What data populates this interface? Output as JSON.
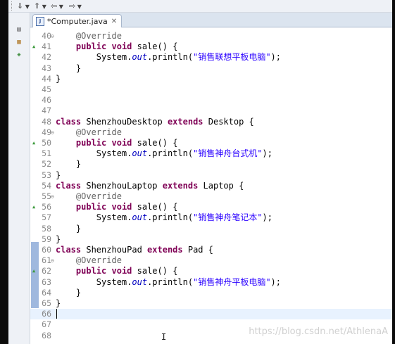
{
  "toolbar": {
    "items": [
      {
        "icon": "next-annotation-icon",
        "glyph": "⇓"
      },
      {
        "icon": "previous-annotation-icon",
        "glyph": "⇑"
      },
      {
        "icon": "back-icon",
        "glyph": "⇦"
      },
      {
        "icon": "forward-icon",
        "glyph": "⇨"
      }
    ]
  },
  "side_panel": {
    "icons": [
      "restore-icon",
      "hierarchy-icon",
      "outline-icon"
    ]
  },
  "editor": {
    "tab_title": "*Computer.java",
    "tab_close_glyph": "✕",
    "file_icon_glyph": "J",
    "current_line": 66,
    "lines": [
      {
        "n": "40",
        "fold": "⊖",
        "marker": "",
        "tokens": [
          [
            "",
            "    "
          ],
          [
            "ann",
            "@Override"
          ]
        ]
      },
      {
        "n": "41",
        "fold": "",
        "marker": "▲",
        "tokens": [
          [
            "",
            "    "
          ],
          [
            "kw",
            "public"
          ],
          [
            "",
            " "
          ],
          [
            "kw",
            "void"
          ],
          [
            "",
            " sale() {"
          ]
        ]
      },
      {
        "n": "42",
        "fold": "",
        "marker": "",
        "tokens": [
          [
            "",
            "        System."
          ],
          [
            "fld",
            "out"
          ],
          [
            "",
            ".println("
          ],
          [
            "str",
            "\"销售联想平板电脑\""
          ],
          [
            "",
            ");"
          ]
        ]
      },
      {
        "n": "43",
        "fold": "",
        "marker": "",
        "tokens": [
          [
            "",
            "    }"
          ]
        ]
      },
      {
        "n": "44",
        "fold": "",
        "marker": "",
        "tokens": [
          [
            "",
            "}"
          ]
        ]
      },
      {
        "n": "45",
        "fold": "",
        "marker": "",
        "tokens": []
      },
      {
        "n": "46",
        "fold": "",
        "marker": "",
        "tokens": []
      },
      {
        "n": "47",
        "fold": "",
        "marker": "",
        "tokens": []
      },
      {
        "n": "48",
        "fold": "",
        "marker": "",
        "tokens": [
          [
            "kw",
            "class"
          ],
          [
            "",
            " ShenzhouDesktop "
          ],
          [
            "kw",
            "extends"
          ],
          [
            "",
            " Desktop {"
          ]
        ]
      },
      {
        "n": "49",
        "fold": "⊖",
        "marker": "",
        "tokens": [
          [
            "",
            "    "
          ],
          [
            "ann",
            "@Override"
          ]
        ]
      },
      {
        "n": "50",
        "fold": "",
        "marker": "▲",
        "tokens": [
          [
            "",
            "    "
          ],
          [
            "kw",
            "public"
          ],
          [
            "",
            " "
          ],
          [
            "kw",
            "void"
          ],
          [
            "",
            " sale() {"
          ]
        ]
      },
      {
        "n": "51",
        "fold": "",
        "marker": "",
        "tokens": [
          [
            "",
            "        System."
          ],
          [
            "fld",
            "out"
          ],
          [
            "",
            ".println("
          ],
          [
            "str",
            "\"销售神舟台式机\""
          ],
          [
            "",
            ");"
          ]
        ]
      },
      {
        "n": "52",
        "fold": "",
        "marker": "",
        "tokens": [
          [
            "",
            "    }"
          ]
        ]
      },
      {
        "n": "53",
        "fold": "",
        "marker": "",
        "tokens": [
          [
            "",
            "}"
          ]
        ]
      },
      {
        "n": "54",
        "fold": "",
        "marker": "",
        "tokens": [
          [
            "kw",
            "class"
          ],
          [
            "",
            " ShenzhouLaptop "
          ],
          [
            "kw",
            "extends"
          ],
          [
            "",
            " Laptop {"
          ]
        ]
      },
      {
        "n": "55",
        "fold": "⊖",
        "marker": "",
        "tokens": [
          [
            "",
            "    "
          ],
          [
            "ann",
            "@Override"
          ]
        ]
      },
      {
        "n": "56",
        "fold": "",
        "marker": "▲",
        "tokens": [
          [
            "",
            "    "
          ],
          [
            "kw",
            "public"
          ],
          [
            "",
            " "
          ],
          [
            "kw",
            "void"
          ],
          [
            "",
            " sale() {"
          ]
        ]
      },
      {
        "n": "57",
        "fold": "",
        "marker": "",
        "tokens": [
          [
            "",
            "        System."
          ],
          [
            "fld",
            "out"
          ],
          [
            "",
            ".println("
          ],
          [
            "str",
            "\"销售神舟笔记本\""
          ],
          [
            "",
            ");"
          ]
        ]
      },
      {
        "n": "58",
        "fold": "",
        "marker": "",
        "tokens": [
          [
            "",
            "    }"
          ]
        ]
      },
      {
        "n": "59",
        "fold": "",
        "marker": "",
        "tokens": [
          [
            "",
            "}"
          ]
        ]
      },
      {
        "n": "60",
        "fold": "",
        "marker": "",
        "tokens": [
          [
            "kw",
            "class"
          ],
          [
            "",
            " ShenzhouPad "
          ],
          [
            "kw",
            "extends"
          ],
          [
            "",
            " Pad {"
          ]
        ]
      },
      {
        "n": "61",
        "fold": "⊖",
        "marker": "",
        "tokens": [
          [
            "",
            "    "
          ],
          [
            "ann",
            "@Override"
          ]
        ]
      },
      {
        "n": "62",
        "fold": "",
        "marker": "▲",
        "tokens": [
          [
            "",
            "    "
          ],
          [
            "kw",
            "public"
          ],
          [
            "",
            " "
          ],
          [
            "kw",
            "void"
          ],
          [
            "",
            " sale() {"
          ]
        ]
      },
      {
        "n": "63",
        "fold": "",
        "marker": "",
        "tokens": [
          [
            "",
            "        System."
          ],
          [
            "fld",
            "out"
          ],
          [
            "",
            ".println("
          ],
          [
            "str",
            "\"销售神舟平板电脑\""
          ],
          [
            "",
            ");"
          ]
        ]
      },
      {
        "n": "64",
        "fold": "",
        "marker": "",
        "tokens": [
          [
            "",
            "    }"
          ]
        ]
      },
      {
        "n": "65",
        "fold": "",
        "marker": "",
        "tokens": [
          [
            "",
            "}"
          ]
        ]
      },
      {
        "n": "66",
        "fold": "",
        "marker": "",
        "tokens": []
      },
      {
        "n": "67",
        "fold": "",
        "marker": "",
        "tokens": []
      },
      {
        "n": "68",
        "fold": "",
        "marker": "",
        "tokens": []
      }
    ]
  },
  "watermark": "https://blog.csdn.net/AthlenaA"
}
